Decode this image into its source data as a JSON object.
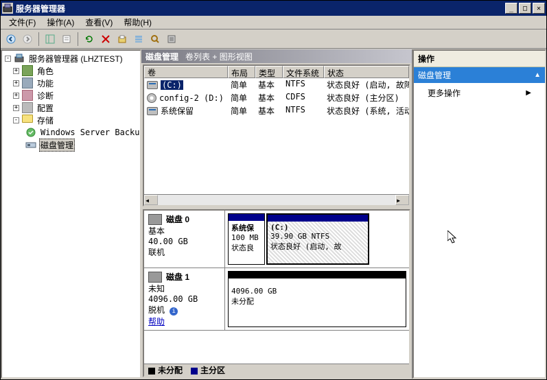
{
  "title": "服务器管理器",
  "menu": {
    "file": "文件(F)",
    "action": "操作(A)",
    "view": "查看(V)",
    "help": "帮助(H)"
  },
  "tree": {
    "root": "服务器管理器 (LHZTEST)",
    "role": "角色",
    "feature": "功能",
    "diag": "诊断",
    "config": "配置",
    "storage": "存储",
    "wsb": "Windows Server Backup",
    "diskmgmt": "磁盘管理"
  },
  "panel": {
    "title": "磁盘管理",
    "subtitle": "卷列表 + 图形视图"
  },
  "cols": {
    "vol": "卷",
    "layout": "布局",
    "type": "类型",
    "fs": "文件系统",
    "status": "状态"
  },
  "vols": [
    {
      "name": "(C:)",
      "layout": "简单",
      "type": "基本",
      "fs": "NTFS",
      "status": "状态良好 (启动, 故障转储, "
    },
    {
      "name": "config-2 (D:)",
      "layout": "简单",
      "type": "基本",
      "fs": "CDFS",
      "status": "状态良好 (主分区)"
    },
    {
      "name": "系统保留",
      "layout": "简单",
      "type": "基本",
      "fs": "NTFS",
      "status": "状态良好 (系统, 活动, 主分"
    }
  ],
  "disk0": {
    "label": "磁盘 0",
    "type": "基本",
    "size": "40.00 GB",
    "status": "联机",
    "p_sys_name": "系统保",
    "p_sys_size": "100 MB",
    "p_sys_status": "状态良",
    "p_c_name": "(C:)",
    "p_c_size": "39.90 GB NTFS",
    "p_c_status": "状态良好 (启动, 故"
  },
  "disk1": {
    "label": "磁盘 1",
    "type": "未知",
    "size": "4096.00 GB",
    "status": "脱机",
    "help": "帮助",
    "p_size": "4096.00 GB",
    "p_status": "未分配"
  },
  "legend": {
    "unalloc": "未分配",
    "primary": "主分区"
  },
  "actions": {
    "header": "操作",
    "sub": "磁盘管理",
    "more": "更多操作"
  }
}
